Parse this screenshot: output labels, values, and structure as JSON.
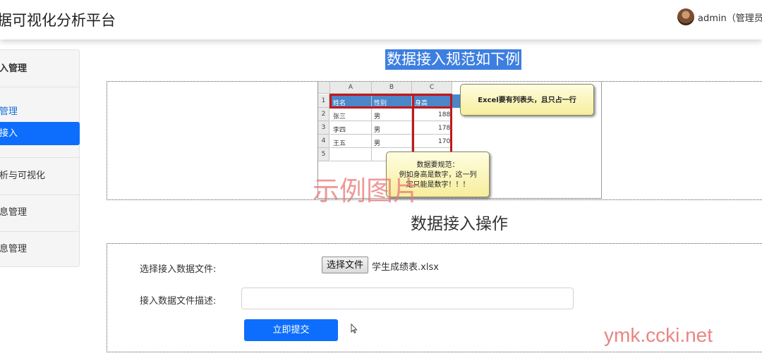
{
  "header": {
    "app_title": "据可视化分析平台",
    "user_label": "admin（管理员"
  },
  "sidebar": {
    "section_title": "入管理",
    "sub_items": [
      "管理",
      "接入"
    ],
    "groups": [
      "析与可视化",
      "息管理",
      "息管理"
    ]
  },
  "spec": {
    "title": "数据接入规范如下例",
    "sample": {
      "columns": [
        "A",
        "B",
        "C"
      ],
      "rows": [
        "1",
        "2",
        "3",
        "4",
        "5"
      ],
      "header_cells": [
        "姓名",
        "性别",
        "身高"
      ],
      "data": [
        [
          "张三",
          "男",
          "188"
        ],
        [
          "李四",
          "男",
          "178"
        ],
        [
          "王五",
          "男",
          "170"
        ]
      ],
      "callout_header": "Excel要有列表头，且只占一行",
      "callout_rule_lines": [
        "数据要规范：",
        "例如身高是数字，这一列",
        "定只能是数字！！！"
      ],
      "watermark": "示例图片"
    }
  },
  "operation": {
    "title": "数据接入操作",
    "file_label": "选择接入数据文件:",
    "file_button": "选择文件",
    "file_name": "学生成绩表.xlsx",
    "desc_label": "接入数据文件描述:",
    "desc_value": "",
    "submit_label": "立即提交"
  },
  "watermark_site": "ymk.ccki.net",
  "colors": {
    "primary": "#0d6efd",
    "highlight": "#3d7fe0",
    "excel_header": "#4a86c8",
    "callout_border": "#c0181c"
  }
}
